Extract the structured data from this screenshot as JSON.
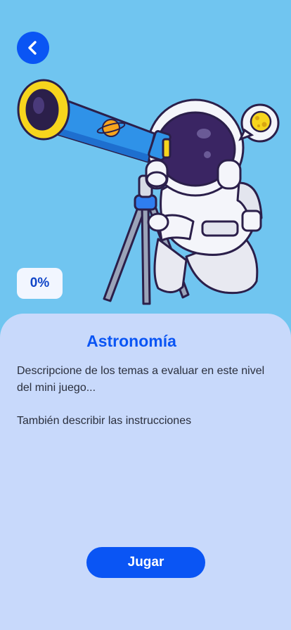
{
  "header": {
    "back_icon": "chevron-left-icon",
    "progress": "0%"
  },
  "illustration": {
    "subject": "astronaut-telescope-illustration",
    "bubble_icon": "moon-icon",
    "decal_icon": "planet-icon"
  },
  "content": {
    "title": "Astronomía",
    "description": "Descripcione de los temas a evaluar en este nivel del mini juego...",
    "instructions": "También describir las instrucciones"
  },
  "actions": {
    "play_label": "Jugar"
  },
  "colors": {
    "background": "#70c5f0",
    "card": "#c8d9fb",
    "accent": "#0a55f4"
  }
}
